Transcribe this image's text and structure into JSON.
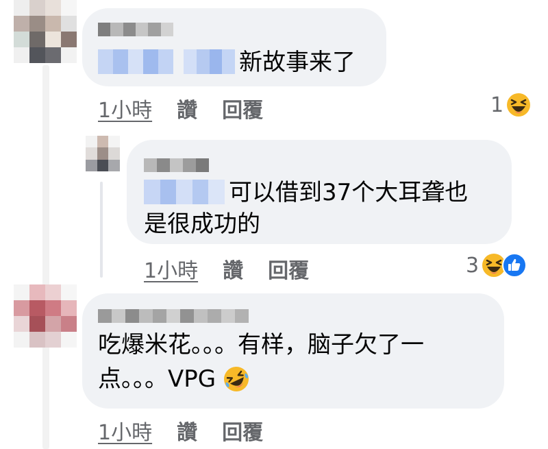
{
  "comments": [
    {
      "text_lines": [
        "新故事来了"
      ],
      "time": "1小時",
      "like_label": "讚",
      "reply_label": "回覆",
      "reaction_count": "1",
      "reaction_icons": [
        "haha-emoji"
      ]
    },
    {
      "text_lines": [
        "可以借到37个大耳聋也",
        "是很成功的"
      ],
      "time": "1小時",
      "like_label": "讚",
      "reply_label": "回覆",
      "reaction_count": "3",
      "reaction_icons": [
        "haha-emoji",
        "like-emoji"
      ]
    },
    {
      "text_lines": [
        "吃爆米花。。。有样，脑子欠了一",
        "点。。。VPG"
      ],
      "time": "1小時",
      "like_label": "讚",
      "reply_label": "回覆",
      "trailing_icon": "rolling-on-floor-laughing-emoji"
    }
  ],
  "colors": {
    "bubble": "#f0f2f5",
    "meta_text": "#65676b",
    "text": "#050505",
    "like_blue": "#1877f2",
    "emoji_yellow": "#f7b928"
  }
}
